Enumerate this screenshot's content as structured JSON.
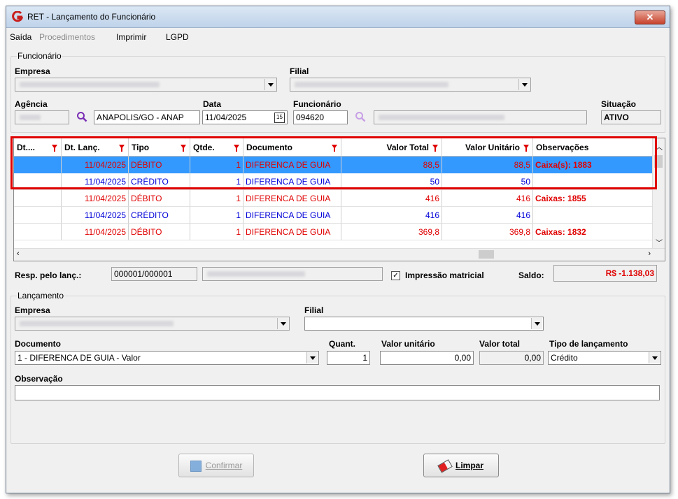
{
  "window": {
    "title": "RET - Lançamento do Funcionário"
  },
  "menu": [
    "Saída",
    "Procedimentos",
    "Imprimir",
    "LGPD"
  ],
  "funcionario_group": {
    "title": "Funcionário",
    "empresa_label": "Empresa",
    "filial_label": "Filial",
    "agencia_label": "Agência",
    "cidade_value": "ANAPOLIS/GO - ANAP",
    "data_label": "Data",
    "data_value": "11/04/2025",
    "funcionario_label": "Funcionário",
    "funcionario_value": "094620",
    "situacao_label": "Situação",
    "situacao_value": "ATIVO"
  },
  "grid": {
    "columns": [
      "Dt....",
      "Dt. Lanç.",
      "Tipo",
      "Qtde.",
      "Documento",
      "Valor Total",
      "Valor Unitário",
      "Observações"
    ],
    "rows": [
      {
        "dt": "",
        "dt_lanc": "11/04/2025",
        "tipo": "DÉBITO",
        "qtde": "1",
        "documento": "DIFERENCA DE GUIA",
        "valor_total": "88,5",
        "valor_unitario": "88,5",
        "obs": "Caixa(s): 1883"
      },
      {
        "dt": "",
        "dt_lanc": "11/04/2025",
        "tipo": "CRÉDITO",
        "qtde": "1",
        "documento": "DIFERENCA DE GUIA",
        "valor_total": "50",
        "valor_unitario": "50",
        "obs": ""
      },
      {
        "dt": "",
        "dt_lanc": "11/04/2025",
        "tipo": "DÉBITO",
        "qtde": "1",
        "documento": "DIFERENCA DE GUIA",
        "valor_total": "416",
        "valor_unitario": "416",
        "obs": "Caixas: 1855"
      },
      {
        "dt": "",
        "dt_lanc": "11/04/2025",
        "tipo": "CRÉDITO",
        "qtde": "1",
        "documento": "DIFERENCA DE GUIA",
        "valor_total": "416",
        "valor_unitario": "416",
        "obs": ""
      },
      {
        "dt": "",
        "dt_lanc": "11/04/2025",
        "tipo": "DÉBITO",
        "qtde": "1",
        "documento": "DIFERENCA DE GUIA",
        "valor_total": "369,8",
        "valor_unitario": "369,8",
        "obs": "Caixas: 1832"
      }
    ]
  },
  "resp": {
    "label": "Resp. pelo lanç.:",
    "code": "000001/000001",
    "impressao_label": "Impressão matricial",
    "saldo_label": "Saldo:",
    "saldo_value": "R$ -1.138,03"
  },
  "lancamento_group": {
    "title": "Lançamento",
    "empresa_label": "Empresa",
    "filial_label": "Filial",
    "documento_label": "Documento",
    "documento_value": "1   - DIFERENCA DE GUIA - Valor",
    "quant_label": "Quant.",
    "quant_value": "1",
    "valor_unitario_label": "Valor unitário",
    "valor_unitario_value": "0,00",
    "valor_total_label": "Valor total",
    "valor_total_value": "0,00",
    "tipo_lancamento_label": "Tipo de lançamento",
    "tipo_lancamento_value": "Crédito",
    "observacao_label": "Observação"
  },
  "buttons": {
    "confirmar": "Confirmar",
    "limpar": "Limpar"
  },
  "colors": {
    "debit": "#e00000",
    "credit": "#0000d8",
    "selection": "#3399ff",
    "highlight": "#e00000"
  }
}
